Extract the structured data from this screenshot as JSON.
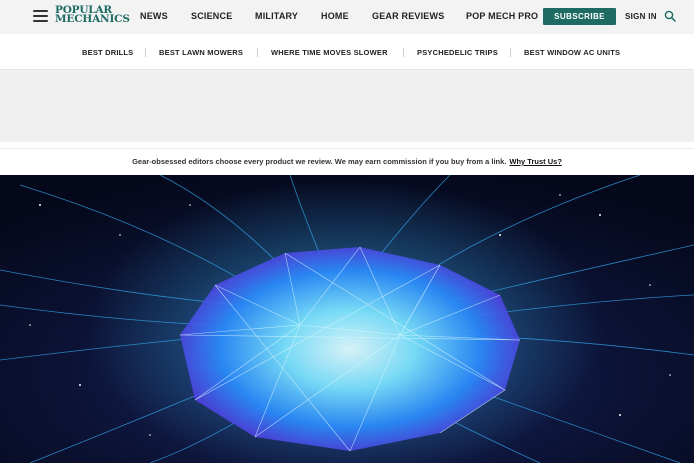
{
  "header": {
    "logo_line1": "POPULAR",
    "logo_line2": "MECHANICS",
    "nav": [
      "NEWS",
      "SCIENCE",
      "MILITARY",
      "HOME",
      "GEAR REVIEWS",
      "POP MECH PRO"
    ],
    "subscribe_label": "SUBSCRIBE",
    "signin_label": "SIGN IN"
  },
  "subnav": {
    "items": [
      "BEST DRILLS",
      "BEST LAWN MOWERS",
      "WHERE TIME MOVES SLOWER",
      "PSYCHEDELIC TRIPS",
      "BEST WINDOW AC UNITS"
    ]
  },
  "disclosure": {
    "text": "Gear-obsessed editors choose every product we review. We may earn commission if you buy from a link.",
    "link": "Why Trust Us?"
  },
  "colors": {
    "brand": "#1d6b63",
    "hero_bg": "#070a1f",
    "hero_glow": "#39c6ff",
    "hero_purple": "#7b3cff"
  },
  "icons": {
    "menu": "hamburger-icon",
    "search": "search-icon"
  }
}
